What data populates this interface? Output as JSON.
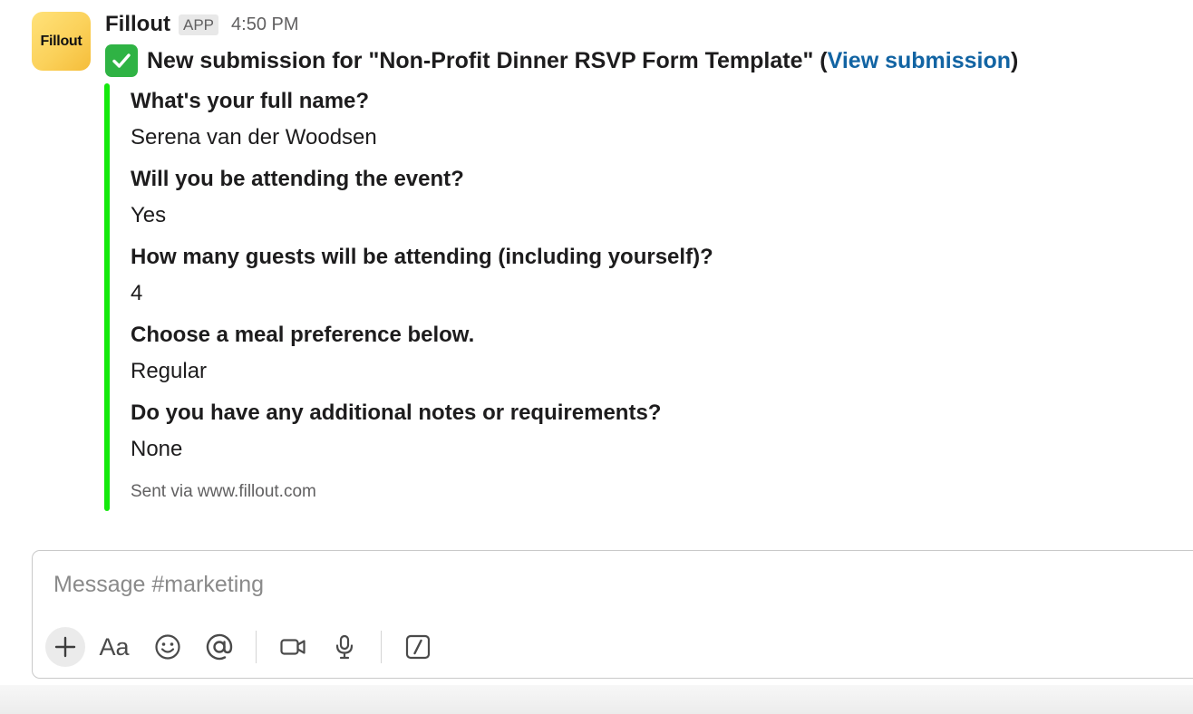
{
  "message": {
    "sender": "Fillout",
    "avatar_text": "Fillout",
    "badge": "APP",
    "time": "4:50 PM",
    "title_prefix": "New submission for \"Non-Profit Dinner RSVP Form Template\" (",
    "title_link": "View submission",
    "title_suffix": ")",
    "title_icon": "white-check-mark-icon",
    "accent_color": "#14e90c",
    "link_color": "#1264a3"
  },
  "fields": [
    {
      "label": "What's your full name?",
      "value": "Serena van der Woodsen"
    },
    {
      "label": "Will you be attending the event?",
      "value": "Yes"
    },
    {
      "label": "How many guests will be attending (including yourself)?",
      "value": "4"
    },
    {
      "label": "Choose a meal preference below.",
      "value": "Regular"
    },
    {
      "label": "Do you have any additional notes or requirements?",
      "value": "None"
    }
  ],
  "footer": "Sent via www.fillout.com",
  "composer": {
    "placeholder": "Message #marketing",
    "value": "",
    "tools": [
      "plus-icon",
      "formatting-icon",
      "emoji-icon",
      "mention-icon",
      "video-icon",
      "microphone-icon",
      "shortcuts-icon"
    ],
    "format_label": "Aa"
  }
}
